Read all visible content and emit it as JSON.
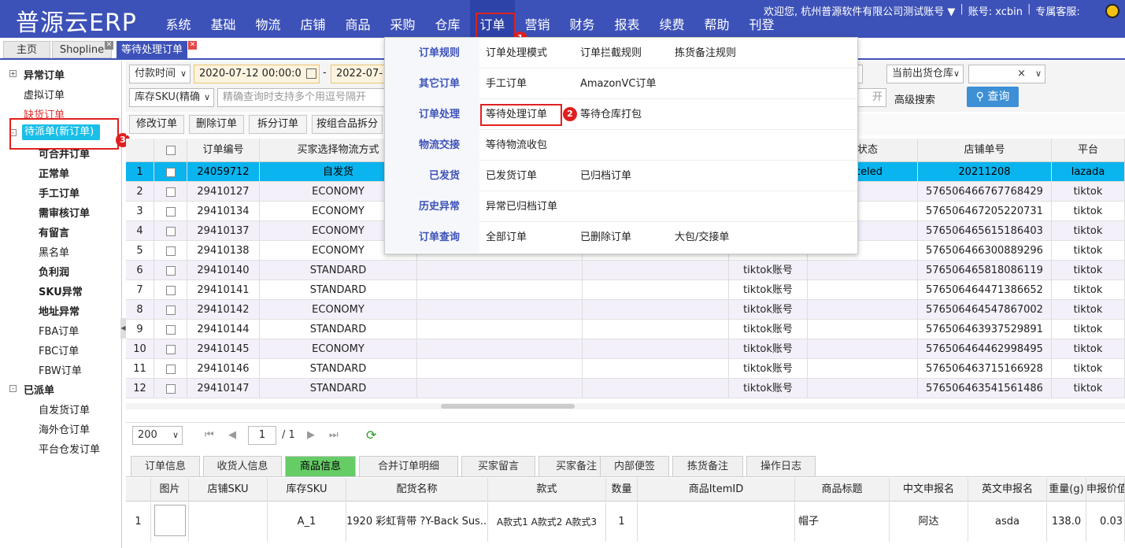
{
  "app": {
    "logo": "普源云ERP"
  },
  "nav": [
    "系统",
    "基础",
    "物流",
    "店铺",
    "商品",
    "采购",
    "仓库",
    "订单",
    "营销",
    "财务",
    "报表",
    "续费",
    "帮助",
    "刊登"
  ],
  "user": {
    "welcome": "欢迎您, 杭州普源软件有限公司测试账号 ▼",
    "sep1": "|",
    "account": "账号: xcbin",
    "sep2": "|",
    "service": "专属客服:"
  },
  "tabs": [
    "主页",
    "Shopline",
    "等待处理订单"
  ],
  "sidebar": {
    "items": [
      "异常订单",
      "虚拟订单",
      "缺货订单",
      "待派单(新订单)",
      "可合并订单",
      "正常单",
      "手工订单",
      "需审核订单",
      "有留言",
      "黑名单",
      "负利润",
      "SKU异常",
      "地址异常",
      "FBA订单",
      "FBC订单",
      "FBW订单",
      "已派单",
      "自发货订单",
      "海外仓订单",
      "平台仓发订单"
    ]
  },
  "filter": {
    "paytime": "付款时间",
    "date_from": "2020-07-12 00:00:0",
    "date_sep": "-",
    "date_to": "2022-07-",
    "stock_sku": "库存SKU(精确",
    "search_placeholder": "精确查询时支持多个用逗号隔开",
    "warehouse": "当前出货仓库",
    "clear": "×",
    "partial_input": "开",
    "advanced": "高级搜索",
    "query": "查询"
  },
  "toolbar": [
    "修改订单",
    "删除订单",
    "拆分订单",
    "按组合品拆分"
  ],
  "grid": {
    "headers": [
      "",
      "",
      "订单编号",
      "买家选择物流方式",
      "",
      "",
      "",
      "单状态",
      "店铺单号",
      "平台"
    ],
    "rows": [
      {
        "n": "1",
        "id": "24059712",
        "ship": "自发货",
        "acct": "",
        "status": "celed",
        "store": "20211208",
        "plat": "lazada"
      },
      {
        "n": "2",
        "id": "29410127",
        "ship": "ECONOMY",
        "acct": "",
        "status": "",
        "store": "576506466767768429",
        "plat": "tiktok"
      },
      {
        "n": "3",
        "id": "29410134",
        "ship": "ECONOMY",
        "acct": "",
        "status": "",
        "store": "576506467205220731",
        "plat": "tiktok"
      },
      {
        "n": "4",
        "id": "29410137",
        "ship": "ECONOMY",
        "acct": "",
        "status": "",
        "store": "576506465615186403",
        "plat": "tiktok"
      },
      {
        "n": "5",
        "id": "29410138",
        "ship": "ECONOMY",
        "acct": "",
        "status": "",
        "store": "576506466300889296",
        "plat": "tiktok"
      },
      {
        "n": "6",
        "id": "29410140",
        "ship": "STANDARD",
        "acct": "tiktok账号",
        "status": "",
        "store": "576506465818086119",
        "plat": "tiktok"
      },
      {
        "n": "7",
        "id": "29410141",
        "ship": "STANDARD",
        "acct": "tiktok账号",
        "status": "",
        "store": "576506464471386652",
        "plat": "tiktok"
      },
      {
        "n": "8",
        "id": "29410142",
        "ship": "ECONOMY",
        "acct": "tiktok账号",
        "status": "",
        "store": "576506464547867002",
        "plat": "tiktok"
      },
      {
        "n": "9",
        "id": "29410144",
        "ship": "STANDARD",
        "acct": "tiktok账号",
        "status": "",
        "store": "576506463937529891",
        "plat": "tiktok"
      },
      {
        "n": "10",
        "id": "29410145",
        "ship": "ECONOMY",
        "acct": "tiktok账号",
        "status": "",
        "store": "576506464462998495",
        "plat": "tiktok"
      },
      {
        "n": "11",
        "id": "29410146",
        "ship": "STANDARD",
        "acct": "tiktok账号",
        "status": "",
        "store": "576506463715166928",
        "plat": "tiktok"
      },
      {
        "n": "12",
        "id": "29410147",
        "ship": "STANDARD",
        "acct": "tiktok账号",
        "status": "",
        "store": "576506463541561486",
        "plat": "tiktok"
      }
    ]
  },
  "pager": {
    "size": "200",
    "page": "1",
    "total": "/ 1"
  },
  "detail_tabs": [
    "订单信息",
    "收货人信息",
    "商品信息",
    "合并订单明细",
    "买家留言",
    "买家备注",
    "内部便签",
    "拣货备注",
    "操作日志"
  ],
  "detail": {
    "headers": [
      "",
      "图片",
      "店铺SKU",
      "库存SKU",
      "配货名称",
      "款式",
      "数量",
      "商品ItemID",
      "商品标题",
      "中文申报名",
      "英文申报名",
      "重量(g)",
      "申报价值"
    ],
    "row": [
      "1",
      "",
      "",
      "A_1",
      "1920 彩虹背带 ?Y-Back Sus...",
      "A款式1 A款式2 A款式3",
      "1",
      "",
      "帽子",
      "阿达",
      "asda",
      "138.0",
      "0.03"
    ]
  },
  "menu": {
    "rows": [
      {
        "cat": "订单规则",
        "items": [
          "订单处理模式",
          "订单拦截规则",
          "拣货备注规则"
        ]
      },
      {
        "cat": "其它订单",
        "items": [
          "手工订单",
          "AmazonVC订单"
        ]
      },
      {
        "cat": "订单处理",
        "items": [
          "等待处理订单",
          "等待仓库打包"
        ]
      },
      {
        "cat": "物流交接",
        "items": [
          "等待物流收包"
        ]
      },
      {
        "cat": "已发货",
        "items": [
          "已发货订单",
          "已归档订单"
        ]
      },
      {
        "cat": "历史异常",
        "items": [
          "异常已归档订单"
        ]
      },
      {
        "cat": "订单查询",
        "items": [
          "全部订单",
          "已删除订单",
          "大包/交接单"
        ]
      }
    ]
  },
  "badges": [
    "1",
    "2",
    "3"
  ],
  "colors": {
    "brand": "#3d52b8",
    "selected_row": "#0ab4ee",
    "annotation": "#e02020"
  }
}
